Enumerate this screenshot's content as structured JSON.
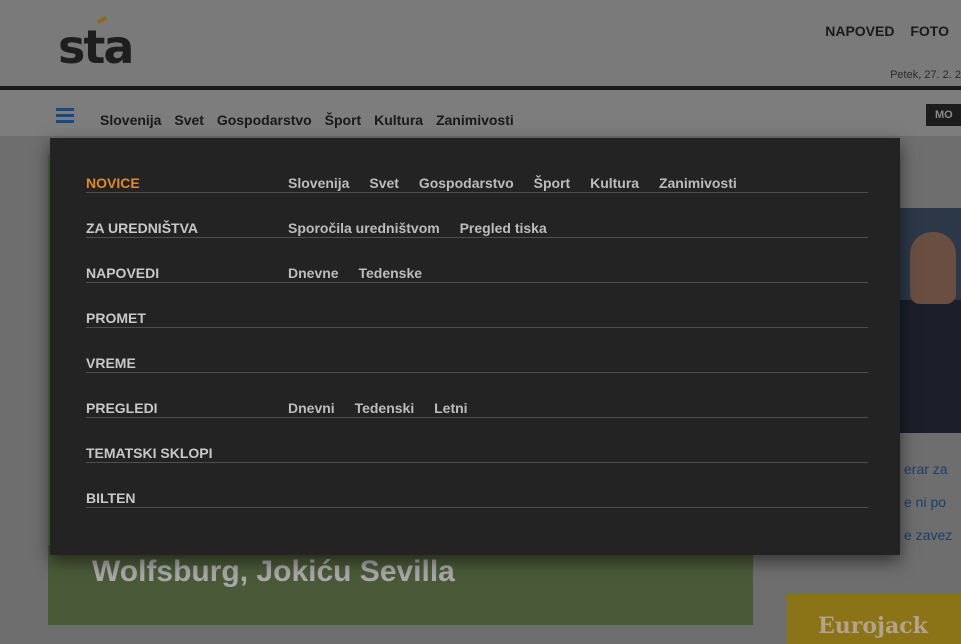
{
  "header": {
    "logo": "sta",
    "top_links": [
      "NAPOVED",
      "FOTO"
    ],
    "date": "Petek, 27. 2. 2"
  },
  "nav": {
    "items": [
      "Slovenija",
      "Svet",
      "Gospodarstvo",
      "Šport",
      "Kultura",
      "Zanimivosti"
    ],
    "right_button": "MO"
  },
  "menu": {
    "rows": [
      {
        "title": "NOVICE",
        "active": true,
        "links": [
          "Slovenija",
          "Svet",
          "Gospodarstvo",
          "Šport",
          "Kultura",
          "Zanimivosti"
        ]
      },
      {
        "title": "ZA UREDNIŠTVA",
        "active": false,
        "links": [
          "Sporočila uredništvom",
          "Pregled tiska"
        ]
      },
      {
        "title": "NAPOVEDI",
        "active": false,
        "links": [
          "Dnevne",
          "Tedenske"
        ]
      },
      {
        "title": "PROMET",
        "active": false,
        "links": []
      },
      {
        "title": "VREME",
        "active": false,
        "links": []
      },
      {
        "title": "PREGLEDI",
        "active": false,
        "links": [
          "Dnevni",
          "Tedenski",
          "Letni"
        ]
      },
      {
        "title": "TEMATSKI SKLOPI",
        "active": false,
        "links": []
      },
      {
        "title": "BILTEN",
        "active": false,
        "links": []
      }
    ]
  },
  "background": {
    "hero_title": "Wolfsburg, Jokiću Sevilla",
    "side_texts": [
      "erar za",
      "e ni po",
      "e zavez"
    ],
    "banner": "Eurojack"
  },
  "colors": {
    "accent": "#e0892a",
    "menu_bg": "#232323",
    "link_blue": "#1c3f6a"
  }
}
